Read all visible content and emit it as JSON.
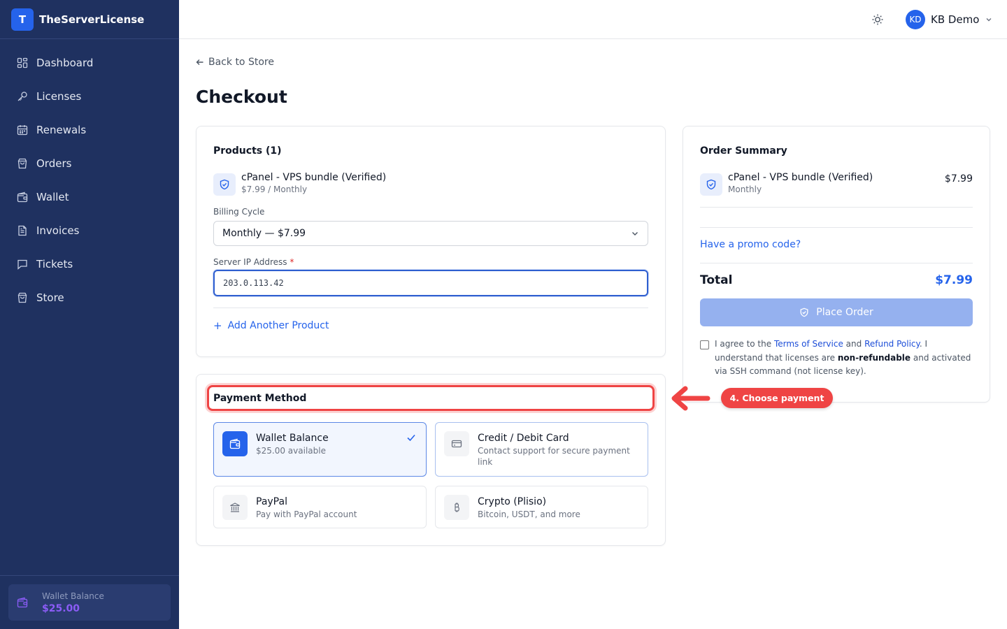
{
  "brand": {
    "logo_letter": "T",
    "name": "TheServerLicense"
  },
  "sidebar": {
    "items": [
      {
        "label": "Dashboard",
        "icon": "dashboard-icon"
      },
      {
        "label": "Licenses",
        "icon": "key-icon"
      },
      {
        "label": "Renewals",
        "icon": "calendar-icon"
      },
      {
        "label": "Orders",
        "icon": "bag-icon"
      },
      {
        "label": "Wallet",
        "icon": "wallet-icon"
      },
      {
        "label": "Invoices",
        "icon": "file-icon"
      },
      {
        "label": "Tickets",
        "icon": "message-icon"
      },
      {
        "label": "Store",
        "icon": "store-bag-icon"
      }
    ],
    "wallet": {
      "label": "Wallet Balance",
      "amount": "$25.00"
    }
  },
  "topbar": {
    "theme_icon": "sun-icon",
    "user": {
      "initials": "KD",
      "name": "KB Demo"
    }
  },
  "main": {
    "back_label": "Back to Store",
    "title": "Checkout",
    "products": {
      "title": "Products (1)",
      "item": {
        "name": "cPanel - VPS bundle (Verified)",
        "price_line": "$7.99 / Monthly"
      },
      "billing_label": "Billing Cycle",
      "billing_value": "Monthly — $7.99",
      "ip_label": "Server IP Address",
      "ip_required": "*",
      "ip_value": "203.0.113.42",
      "add_another": "Add Another Product"
    },
    "payment": {
      "title": "Payment Method",
      "options": [
        {
          "name": "Wallet Balance",
          "desc": "$25.00 available",
          "selected": true,
          "icon": "wallet-icon"
        },
        {
          "name": "Credit / Debit Card",
          "desc": "Contact support for secure payment link",
          "selected": false,
          "icon": "credit-card-icon"
        },
        {
          "name": "PayPal",
          "desc": "Pay with PayPal account",
          "selected": false,
          "icon": "bank-icon"
        },
        {
          "name": "Crypto (Plisio)",
          "desc": "Bitcoin, USDT, and more",
          "selected": false,
          "icon": "bitcoin-icon"
        }
      ]
    },
    "summary": {
      "title": "Order Summary",
      "item": {
        "name": "cPanel - VPS bundle (Verified)",
        "cycle": "Monthly",
        "price": "$7.99"
      },
      "promo_label": "Have a promo code?",
      "total_label": "Total",
      "total_value": "$7.99",
      "place_order": "Place Order",
      "agree": {
        "prefix": "I agree to the ",
        "terms": "Terms of Service",
        "and": " and ",
        "refund": "Refund Policy",
        "middle": ". I understand that licenses are ",
        "bold": "non-refundable",
        "suffix": " and activated via SSH command (not license key)."
      }
    }
  },
  "annotation": {
    "callout": "4. Choose payment",
    "color": "#ef4444"
  },
  "colors": {
    "sidebar_bg": "#1f3160",
    "accent": "#2563eb",
    "wallet_accent": "#8b5cf6"
  }
}
